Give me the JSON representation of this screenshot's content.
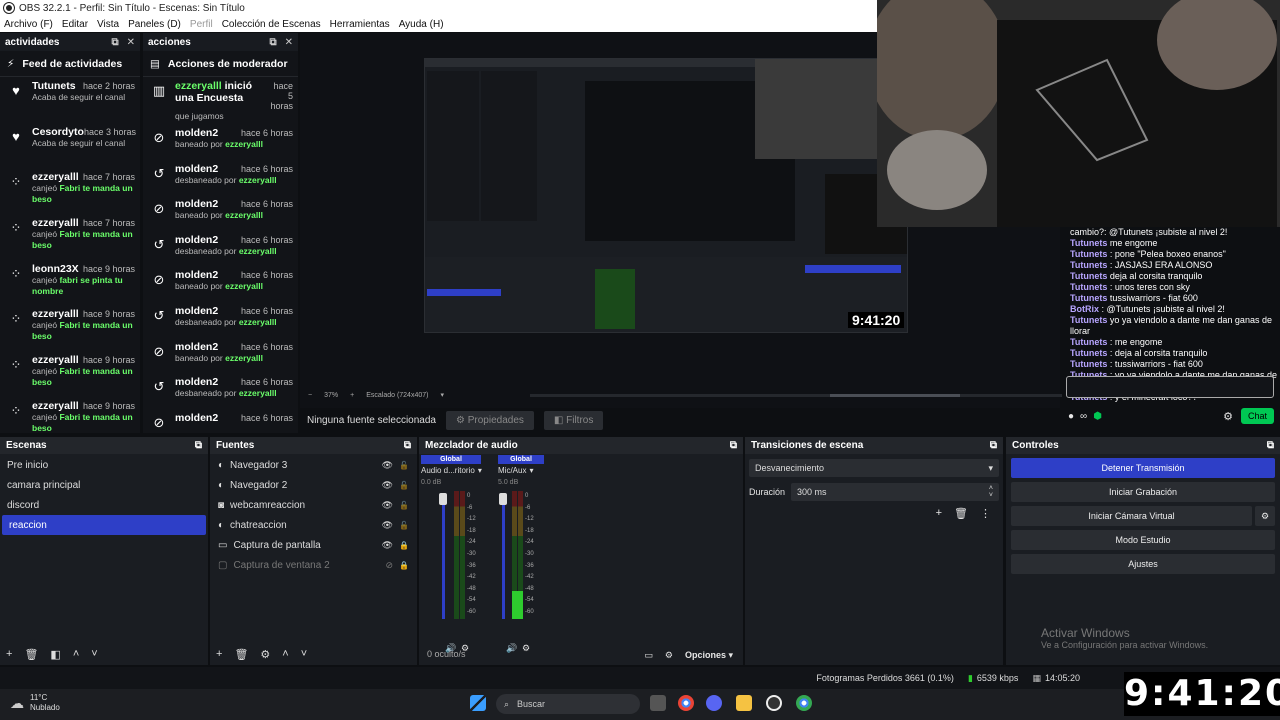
{
  "window": {
    "title": "OBS 32.2.1 - Perfil: Sin Título - Escenas: Sin Título"
  },
  "menu": [
    "Archivo (F)",
    "Editar",
    "Vista",
    "Paneles (D)",
    "Perfil",
    "Colección de Escenas",
    "Herramientas",
    "Ayuda (H)"
  ],
  "activity_dock": {
    "tab": "actividades",
    "title": "Feed de actividades",
    "items": [
      {
        "icon": "heart-icon",
        "name": "Tutunets",
        "time": "hace 2 horas",
        "text": "Acaba de seguir el canal",
        "reward": ""
      },
      {
        "icon": "heart-icon",
        "name": "Cesordyto",
        "time": "hace 3 horas",
        "text": "Acaba de seguir el canal",
        "reward": ""
      },
      {
        "icon": "points-icon",
        "name": "ezzeryalll",
        "time": "hace 7 horas",
        "text": "canjeó",
        "reward": "Fabri te manda un beso"
      },
      {
        "icon": "points-icon",
        "name": "ezzeryalll",
        "time": "hace 7 horas",
        "text": "canjeó",
        "reward": "Fabri te manda un beso"
      },
      {
        "icon": "points-icon",
        "name": "leonn23X",
        "time": "hace 9 horas",
        "text": "canjeó",
        "reward": "fabri se pinta tu nombre"
      },
      {
        "icon": "points-icon",
        "name": "ezzeryalll",
        "time": "hace 9 horas",
        "text": "canjeó",
        "reward": "Fabri te manda un beso"
      },
      {
        "icon": "points-icon",
        "name": "ezzeryalll",
        "time": "hace 9 horas",
        "text": "canjeó",
        "reward": "Fabri te manda un beso"
      },
      {
        "icon": "points-icon",
        "name": "ezzeryalll",
        "time": "hace 9 horas",
        "text": "canjeó",
        "reward": "Fabri te manda un beso"
      }
    ]
  },
  "mod_dock": {
    "tab": "acciones",
    "title": "Acciones de moderador",
    "poll": {
      "name": "ezzeryalll",
      "action": "inició una Encuesta",
      "time": "hace 5 horas",
      "text": "que jugamos"
    },
    "items": [
      {
        "icon": "ban-icon",
        "name": "molden2",
        "time": "hace 6 horas",
        "action": "baneado por",
        "by": "ezzeryalll"
      },
      {
        "icon": "unban-icon",
        "name": "molden2",
        "time": "hace 6 horas",
        "action": "desbaneado por",
        "by": "ezzeryalll"
      },
      {
        "icon": "ban-icon",
        "name": "molden2",
        "time": "hace 6 horas",
        "action": "baneado por",
        "by": "ezzeryalll"
      },
      {
        "icon": "unban-icon",
        "name": "molden2",
        "time": "hace 6 horas",
        "action": "desbaneado por",
        "by": "ezzeryalll"
      },
      {
        "icon": "ban-icon",
        "name": "molden2",
        "time": "hace 6 horas",
        "action": "baneado por",
        "by": "ezzeryalll"
      },
      {
        "icon": "unban-icon",
        "name": "molden2",
        "time": "hace 6 horas",
        "action": "desbaneado por",
        "by": "ezzeryalll"
      },
      {
        "icon": "ban-icon",
        "name": "molden2",
        "time": "hace 6 horas",
        "action": "baneado por",
        "by": "ezzeryalll"
      },
      {
        "icon": "unban-icon",
        "name": "molden2",
        "time": "hace 6 horas",
        "action": "desbaneado por",
        "by": "ezzeryalll"
      },
      {
        "icon": "ban-icon",
        "name": "molden2",
        "time": "hace 6 horas",
        "action": "",
        "by": ""
      }
    ]
  },
  "preview": {
    "clock": "9:41:20",
    "zoom": "37%",
    "scale_label": "Escalado (724x407)",
    "no_source": "Ninguna fuente seleccionada",
    "properties": "Propiedades",
    "filters": "Filtros"
  },
  "chat": {
    "lines": [
      {
        "user": "",
        "text": "cambio?: @Tutunets ¡subiste al nivel 2!"
      },
      {
        "user": "Tutunets",
        "text": "me engome"
      },
      {
        "user": "Tutunets",
        "text": ": pone \"Pelea boxeo enanos\""
      },
      {
        "user": "Tutunets",
        "text": ": JASJASJ ERA ALONSO"
      },
      {
        "user": "Tutunets",
        "text": "deja al corsita tranquilo"
      },
      {
        "user": "Tutunets",
        "text": ": unos teres con sky"
      },
      {
        "user": "Tutunets",
        "text": "tussiwarriors - fiat 600"
      },
      {
        "user": "BotRix",
        "text": ": @Tutunets ¡subiste al nivel 2!"
      },
      {
        "user": "Tutunets",
        "text": "yo ya viendolo a dante me dan ganas de llorar"
      },
      {
        "user": "Tutunets",
        "text": ": me engome"
      },
      {
        "user": "Tutunets",
        "text": ": deja al corsita tranquilo"
      },
      {
        "user": "Tutunets",
        "text": ": tussiwarriors - fiat 600"
      },
      {
        "user": "Tutunets",
        "text": ": yo ya viendolo a dante me dan ganas de llorar"
      },
      {
        "user": "Tutunets",
        "text": ": y el minecraft loco??"
      }
    ],
    "send_label": "Chat"
  },
  "scenes": {
    "title": "Escenas",
    "items": [
      "Pre inicio",
      "camara principal",
      "discord",
      "reaccion"
    ],
    "selected": "reaccion"
  },
  "sources": {
    "title": "Fuentes",
    "items": [
      {
        "name": "Navegador 3",
        "icon": "browser-icon",
        "visible": true,
        "locked": false
      },
      {
        "name": "Navegador 2",
        "icon": "browser-icon",
        "visible": true,
        "locked": false
      },
      {
        "name": "webcamreaccion",
        "icon": "camera-icon",
        "visible": true,
        "locked": false
      },
      {
        "name": "chatreaccion",
        "icon": "browser-icon",
        "visible": true,
        "locked": false
      },
      {
        "name": "Captura de pantalla",
        "icon": "monitor-icon",
        "visible": true,
        "locked": true
      },
      {
        "name": "Captura de ventana 2",
        "icon": "window-icon",
        "visible": false,
        "locked": true
      }
    ]
  },
  "mixer": {
    "title": "Mezclador de audio",
    "channels": [
      {
        "tag": "Global",
        "name": "Audio d...ritorio",
        "db": "0.0 dB",
        "level": 0.0
      },
      {
        "tag": "Global",
        "name": "Mic/Aux",
        "db": "5.0 dB",
        "level": 0.2
      }
    ],
    "scale": [
      "0",
      "-6",
      "-12",
      "-18",
      "-24",
      "-30",
      "-36",
      "-42",
      "-48",
      "-54",
      "-60"
    ],
    "hidden": "0 oculto/s",
    "options": "Opciones"
  },
  "transitions": {
    "title": "Transiciones de escena",
    "type": "Desvanecimiento",
    "duration_label": "Duración",
    "duration": "300 ms"
  },
  "controls": {
    "title": "Controles",
    "stop_stream": "Detener Transmisión",
    "start_recording": "Iniciar Grabación",
    "start_virtual_cam": "Iniciar Cámara Virtual",
    "studio_mode": "Modo Estudio",
    "settings": "Ajustes"
  },
  "watermark": {
    "line1": "Activar Windows",
    "line2": "Ve a Configuración para activar Windows."
  },
  "status": {
    "dropped": "Fotogramas Perdidos 3661 (0.1%)",
    "bitrate": "6539 kbps",
    "time": "14:05:20"
  },
  "taskbar": {
    "temp": "11°C",
    "weather": "Nublado",
    "search_placeholder": "Buscar"
  },
  "overlay_clock": "9:41:20",
  "colors": {
    "accent": "#2e3fc7",
    "green": "#6bff6b",
    "chat_name": "#b7a5ff",
    "button_green": "#00c853"
  }
}
